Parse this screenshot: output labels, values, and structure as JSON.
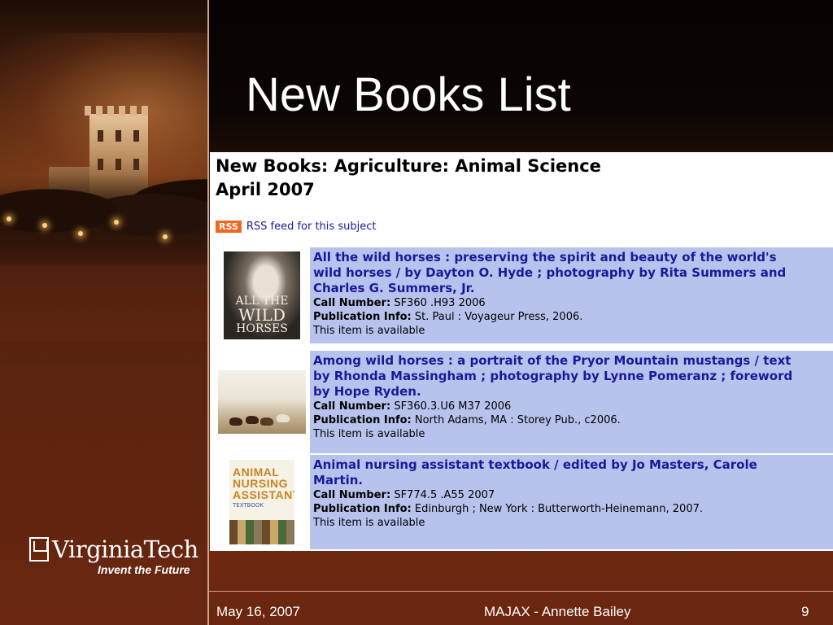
{
  "slide": {
    "title": "New Books List",
    "logo": {
      "wordmark": "VirginiaTech",
      "tagline": "Invent the Future"
    },
    "footer": {
      "date": "May 16, 2007",
      "center": "MAJAX - Annette Bailey",
      "page": "9"
    }
  },
  "page": {
    "heading_line1": "New Books: Agriculture: Animal Science",
    "heading_line2": "April 2007",
    "rss": {
      "badge": "RSS",
      "link": "RSS feed for this subject"
    },
    "labels": {
      "call_number": "Call Number:",
      "publication": "Publication Info:"
    },
    "books": [
      {
        "title_lines": [
          "All the wild horses : preserving the spirit and beauty of the world's",
          "wild horses / by Dayton O. Hyde ; photography by Rita Summers and",
          "Charles G. Summers, Jr."
        ],
        "call_number": "SF360 .H93 2006",
        "publication": "St. Paul : Voyageur Press, 2006.",
        "status": "This item is available",
        "cover_text": [
          "ALL THE",
          "WILD",
          "HORSES"
        ]
      },
      {
        "title_lines": [
          "Among wild horses : a portrait of the Pryor Mountain mustangs / text",
          "by Rhonda Massingham ; photography by Lynne Pomeranz ; foreword",
          "by Hope Ryden."
        ],
        "call_number": "SF360.3.U6 M37 2006",
        "publication": "North Adams, MA : Storey Pub., c2006.",
        "status": "This item is available"
      },
      {
        "title_lines": [
          "Animal nursing assistant textbook / edited by Jo Masters, Carole",
          "Martin."
        ],
        "call_number": "SF774.5 .A55 2007",
        "publication": "Edinburgh ; New York : Butterworth-Heinemann, 2007.",
        "status": "This item is available",
        "cover_text": [
          "ANIMAL",
          "NURSING",
          "ASSISTANT",
          "TEXTBOOK"
        ]
      }
    ]
  },
  "colors": {
    "link": "#1a1a99",
    "row_bg": "#b7c3ec",
    "rss": "#f26722",
    "slide_bg": "#6a2810"
  }
}
